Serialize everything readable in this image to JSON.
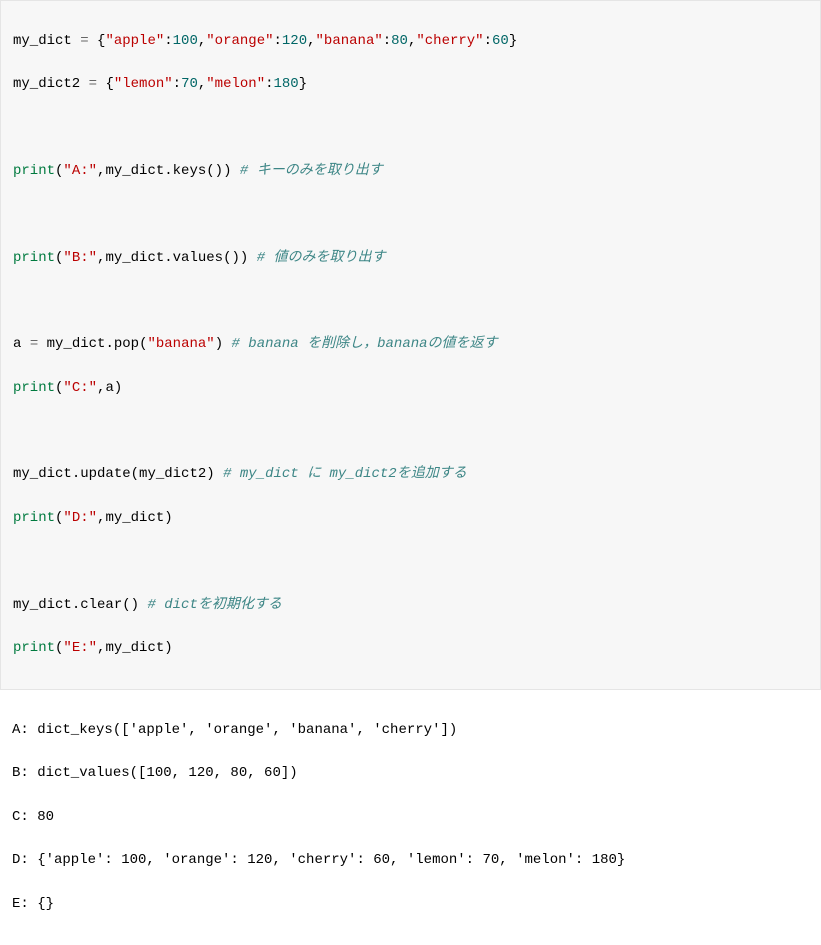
{
  "code": {
    "l1": {
      "v1": "my_dict ",
      "op": "=",
      "sp": " ",
      "b1": "{",
      "s1": "\"apple\"",
      "c1": ":",
      "n1": "100",
      "cm1": ",",
      "s2": "\"orange\"",
      "c2": ":",
      "n2": "120",
      "cm2": ",",
      "s3": "\"banana\"",
      "c3": ":",
      "n3": "80",
      "cm3": ",",
      "s4": "\"cherry\"",
      "c4": ":",
      "n4": "60",
      "b2": "}"
    },
    "l2": {
      "v1": "my_dict2 ",
      "op": "=",
      "sp": " ",
      "b1": "{",
      "s1": "\"lemon\"",
      "c1": ":",
      "n1": "70",
      "cm1": ",",
      "s2": "\"melon\"",
      "c2": ":",
      "n2": "180",
      "b2": "}"
    },
    "l4": {
      "fn": "print",
      "p1": "(",
      "s1": "\"A:\"",
      "cm": ",",
      "v": "my_dict",
      "dot": ".",
      "m": "keys",
      "p2": "())",
      "sp": " ",
      "cmt": "# キーのみを取り出す"
    },
    "l6": {
      "fn": "print",
      "p1": "(",
      "s1": "\"B:\"",
      "cm": ",",
      "v": "my_dict",
      "dot": ".",
      "m": "values",
      "p2": "())",
      "sp": " ",
      "cmt": "# 値のみを取り出す"
    },
    "l8": {
      "v": "a ",
      "op": "=",
      "sp": " ",
      "v2": "my_dict",
      "dot": ".",
      "m": "pop",
      "p1": "(",
      "s1": "\"banana\"",
      "p2": ")",
      "sp2": " ",
      "cmt": "# banana を削除し，bananaの値を返す"
    },
    "l9": {
      "fn": "print",
      "p1": "(",
      "s1": "\"C:\"",
      "cm": ",",
      "v": "a",
      "p2": ")"
    },
    "l11": {
      "v": "my_dict",
      "dot": ".",
      "m": "update",
      "p1": "(",
      "v2": "my_dict2",
      "p2": ")",
      "sp": " ",
      "cmt": "# my_dict に my_dict2を追加する"
    },
    "l12": {
      "fn": "print",
      "p1": "(",
      "s1": "\"D:\"",
      "cm": ",",
      "v": "my_dict",
      "p2": ")"
    },
    "l14": {
      "v": "my_dict",
      "dot": ".",
      "m": "clear",
      "p1": "()",
      "sp": " ",
      "cmt": "# dictを初期化する"
    },
    "l15": {
      "fn": "print",
      "p1": "(",
      "s1": "\"E:\"",
      "cm": ",",
      "v": "my_dict",
      "p2": ")"
    }
  },
  "output": {
    "o1": "A: dict_keys(['apple', 'orange', 'banana', 'cherry'])",
    "o2": "B: dict_values([100, 120, 80, 60])",
    "o3": "C: 80",
    "o4": "D: {'apple': 100, 'orange': 120, 'cherry': 60, 'lemon': 70, 'melon': 180}",
    "o5": "E: {}"
  }
}
